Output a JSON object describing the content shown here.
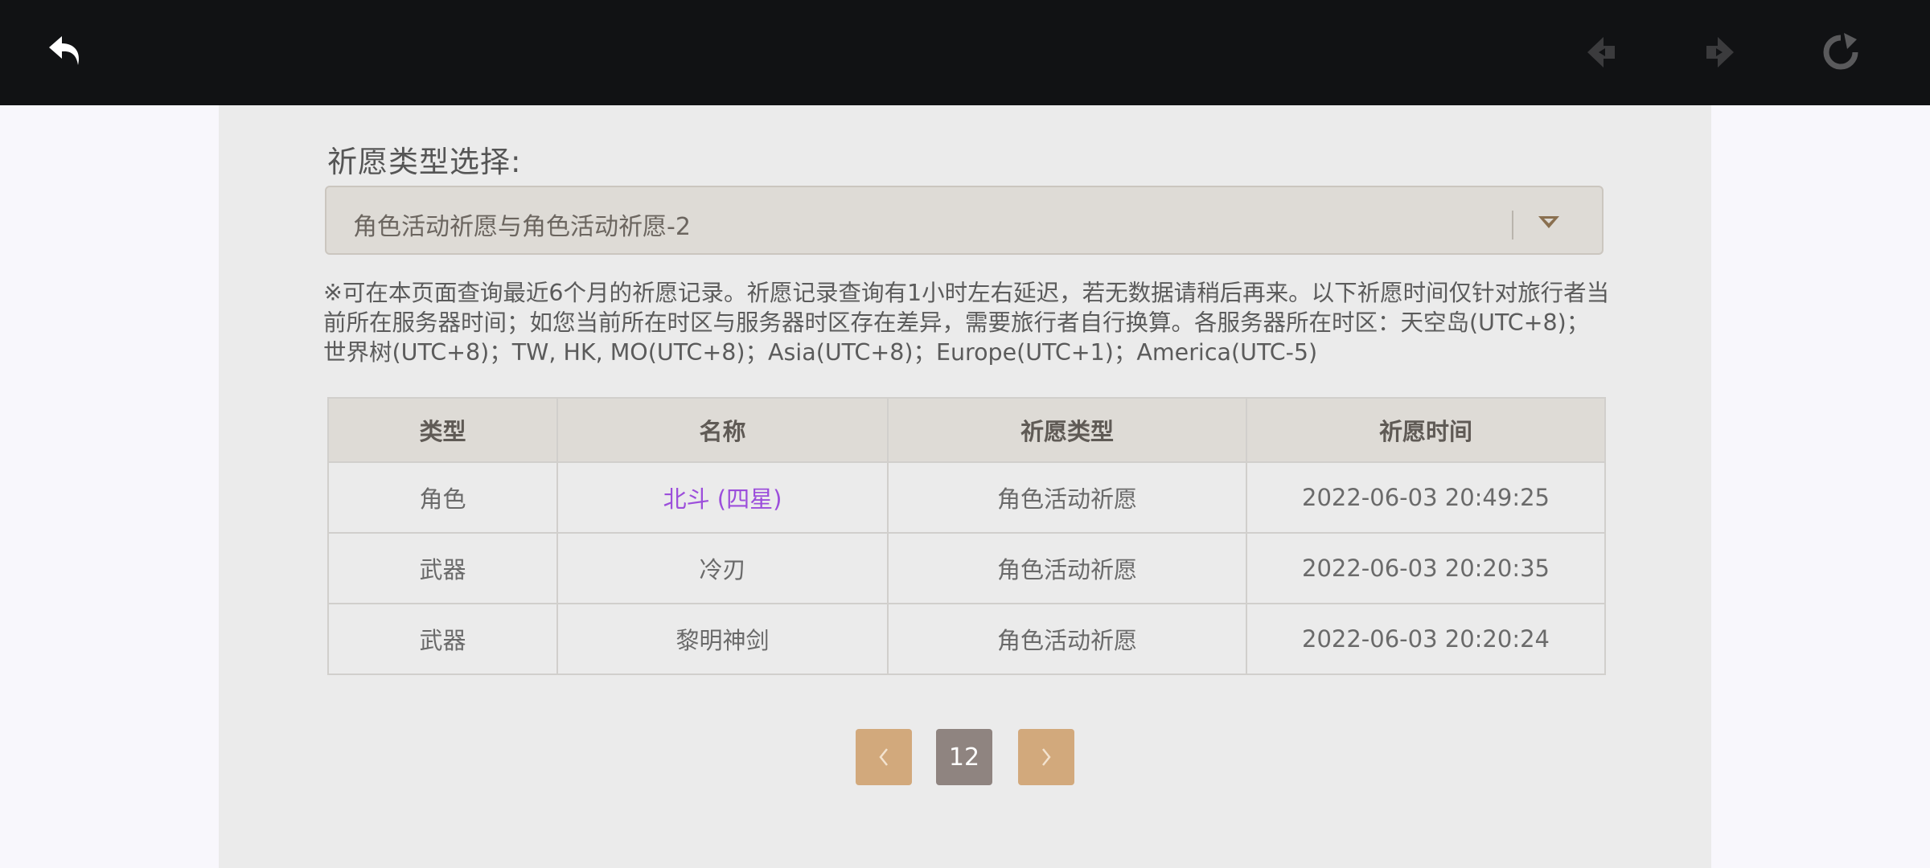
{
  "topbar": {
    "back_icon": "back-arrow-icon",
    "prev_icon": "nav-back-icon",
    "next_icon": "nav-forward-icon",
    "refresh_icon": "refresh-icon"
  },
  "filter": {
    "label": "祈愿类型选择:",
    "selected": "角色活动祈愿与角色活动祈愿-2"
  },
  "notice": "※可在本页面查询最近6个月的祈愿记录。祈愿记录查询有1小时左右延迟，若无数据请稍后再来。以下祈愿时间仅针对旅行者当前所在服务器时间；如您当前所在时区与服务器时区存在差异，需要旅行者自行换算。各服务器所在时区：天空岛(UTC+8)；世界树(UTC+8)；TW, HK, MO(UTC+8)；Asia(UTC+8)；Europe(UTC+1)；America(UTC-5)",
  "table": {
    "headers": [
      "类型",
      "名称",
      "祈愿类型",
      "祈愿时间"
    ],
    "rows": [
      [
        "角色",
        "北斗 (四星)",
        "角色活动祈愿",
        "2022-06-03 20:49:25"
      ],
      [
        "武器",
        "冷刃",
        "角色活动祈愿",
        "2022-06-03 20:20:35"
      ],
      [
        "武器",
        "黎明神剑",
        "角色活动祈愿",
        "2022-06-03 20:20:24"
      ]
    ]
  },
  "pagination": {
    "current_page": "12",
    "prev_icon": "chevron-left-icon",
    "next_icon": "chevron-right-icon"
  },
  "colors": {
    "topbar": "#111214",
    "panel": "#ebebeb",
    "header_bg": "#dedbd6",
    "highlight_four_star": "#9c4edb",
    "pager_button": "#d2a97c",
    "pager_current": "#8f8480"
  }
}
